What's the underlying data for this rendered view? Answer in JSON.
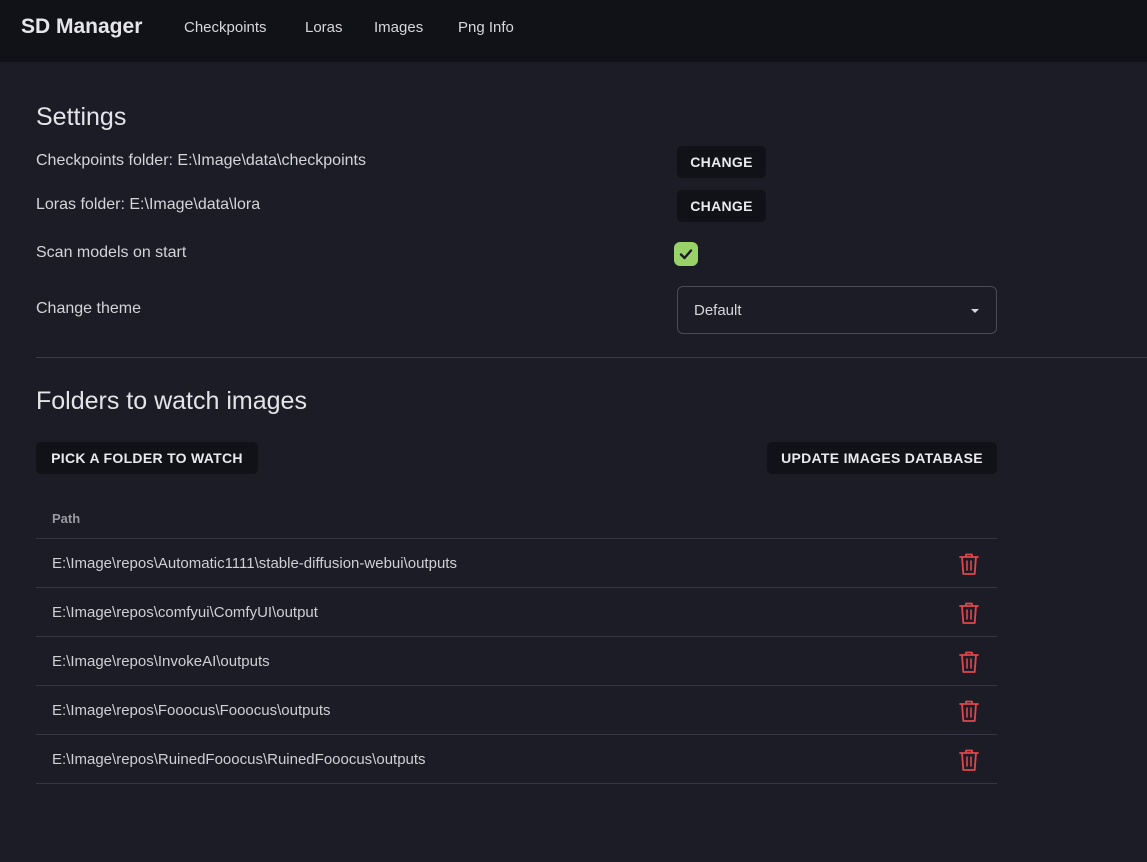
{
  "navbar": {
    "brand": "SD Manager",
    "links": [
      "Checkpoints",
      "Loras",
      "Images",
      "Png Info"
    ]
  },
  "settings": {
    "title": "Settings",
    "checkpoints_folder_label": "Checkpoints folder: E:\\Image\\data\\checkpoints",
    "loras_folder_label": "Loras folder: E:\\Image\\data\\lora",
    "change_label": "CHANGE",
    "scan_label": "Scan models on start",
    "scan_checked": true,
    "theme_label": "Change theme",
    "theme_value": "Default"
  },
  "folders": {
    "title": "Folders to watch images",
    "pick_button": "PICK A FOLDER TO WATCH",
    "update_button": "UPDATE IMAGES DATABASE",
    "column_path": "Path",
    "rows": [
      "E:\\Image\\repos\\Automatic1111\\stable-diffusion-webui\\outputs",
      "E:\\Image\\repos\\comfyui\\ComfyUI\\output",
      "E:\\Image\\repos\\InvokeAI\\outputs",
      "E:\\Image\\repos\\Fooocus\\Fooocus\\outputs",
      "E:\\Image\\repos\\RuinedFooocus\\RuinedFooocus\\outputs"
    ]
  },
  "colors": {
    "background": "#1b1c25",
    "navbar": "#111217",
    "checkbox": "#9ad26a",
    "delete": "#e0474c"
  }
}
